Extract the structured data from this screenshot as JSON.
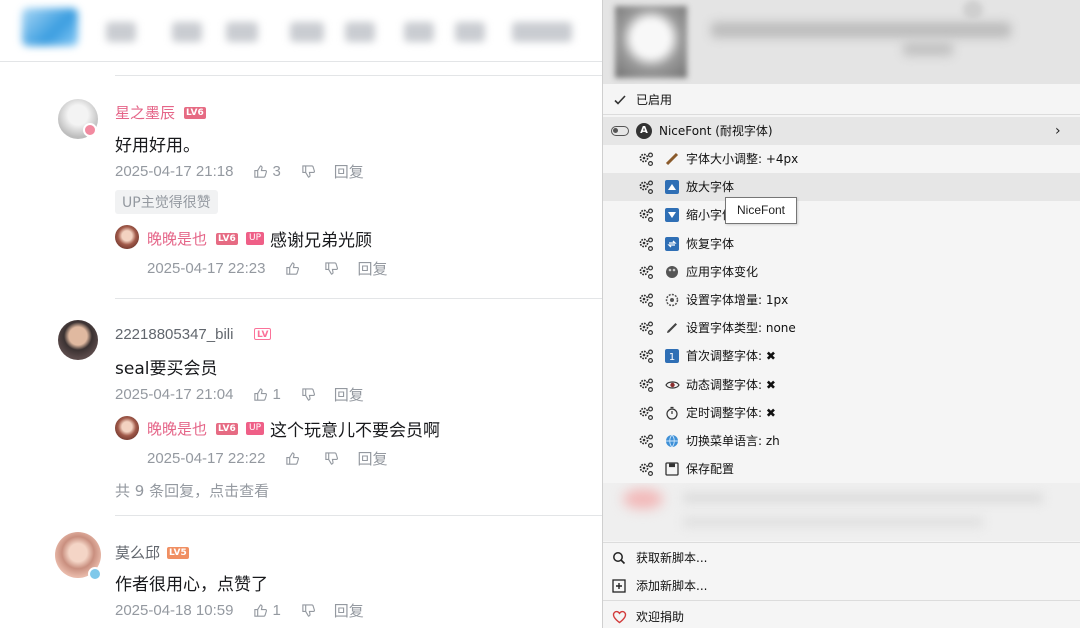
{
  "colors": {
    "accent_pink": "#e56588",
    "meta_gray": "#9499a0",
    "menu_bg": "#f5f5f5",
    "highlight": "#e6e6e6"
  },
  "comments": [
    {
      "user": "星之墨辰",
      "level": "LV6",
      "text": "好用好用。",
      "time": "2025-04-17 21:18",
      "likes": "3",
      "reply_label": "回复",
      "up_badge": "UP主觉得很赞",
      "replies": [
        {
          "user": "晚晚是也",
          "level": "LV6",
          "up_tag": "UP",
          "text": "感谢兄弟光顾",
          "time": "2025-04-17 22:23",
          "reply_label": "回复"
        }
      ]
    },
    {
      "user": "22218805347_bili",
      "level": "LV",
      "text": "seal要买会员",
      "time": "2025-04-17 21:04",
      "likes": "1",
      "reply_label": "回复",
      "replies": [
        {
          "user": "晚晚是也",
          "level": "LV6",
          "up_tag": "UP",
          "text": "这个玩意儿不要会员啊",
          "time": "2025-04-17 22:22",
          "reply_label": "回复"
        }
      ],
      "more_replies": "共 9 条回复，点击查看"
    },
    {
      "user": "莫么邱",
      "level": "LV5",
      "text": "作者很用心，点赞了",
      "time": "2025-04-18 10:59",
      "likes": "1",
      "reply_label": "回复"
    }
  ],
  "menu": {
    "enabled_label": "已启用",
    "script_name": "NiceFont (耐视字体)",
    "items": [
      {
        "icon": "ruler-icon",
        "label": "字体大小调整: +4px"
      },
      {
        "icon": "up-arrow-icon",
        "label": "放大字体"
      },
      {
        "icon": "down-arrow-icon",
        "label": "缩小字体"
      },
      {
        "icon": "refresh-icon",
        "label": "恢复字体"
      },
      {
        "icon": "palette-icon",
        "label": "应用字体变化"
      },
      {
        "icon": "settings-icon",
        "label": "设置字体增量: 1px"
      },
      {
        "icon": "pen-icon",
        "label": "设置字体类型: none"
      },
      {
        "icon": "one-icon",
        "label": "首次调整字体: ✖"
      },
      {
        "icon": "eye-icon",
        "label": "动态调整字体: ✖"
      },
      {
        "icon": "timer-icon",
        "label": "定时调整字体: ✖"
      },
      {
        "icon": "globe-icon",
        "label": "切换菜单语言: zh"
      },
      {
        "icon": "floppy-icon",
        "label": "保存配置"
      }
    ],
    "get_scripts": "获取新脚本...",
    "add_script": "添加新脚本...",
    "donate": "欢迎捐助"
  },
  "tooltip": "NiceFont"
}
